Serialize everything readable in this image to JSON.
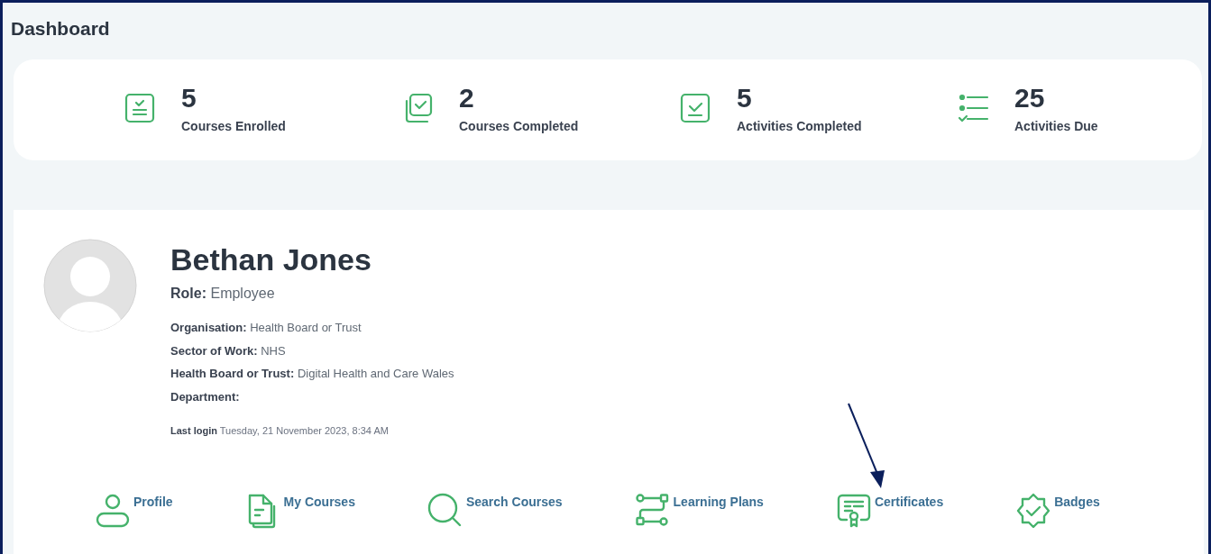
{
  "title": "Dashboard",
  "stats": [
    {
      "value": "5",
      "label": "Courses Enrolled"
    },
    {
      "value": "2",
      "label": "Courses Completed"
    },
    {
      "value": "5",
      "label": "Activities Completed"
    },
    {
      "value": "25",
      "label": "Activities Due"
    }
  ],
  "profile": {
    "name": "Bethan Jones",
    "role_label": "Role:",
    "role": "Employee",
    "details": [
      {
        "label": "Organisation:",
        "value": "Health Board or Trust"
      },
      {
        "label": "Sector of Work:",
        "value": "NHS"
      },
      {
        "label": "Health Board or Trust:",
        "value": "Digital Health and Care Wales"
      },
      {
        "label": "Department:"
      }
    ],
    "last_login_label": "Last login",
    "last_login": "Tuesday, 21 November 2023, 8:34 AM"
  },
  "links": [
    "Profile",
    "My Courses",
    "Search Courses",
    "Learning Plans",
    "Certificates",
    "Badges"
  ]
}
